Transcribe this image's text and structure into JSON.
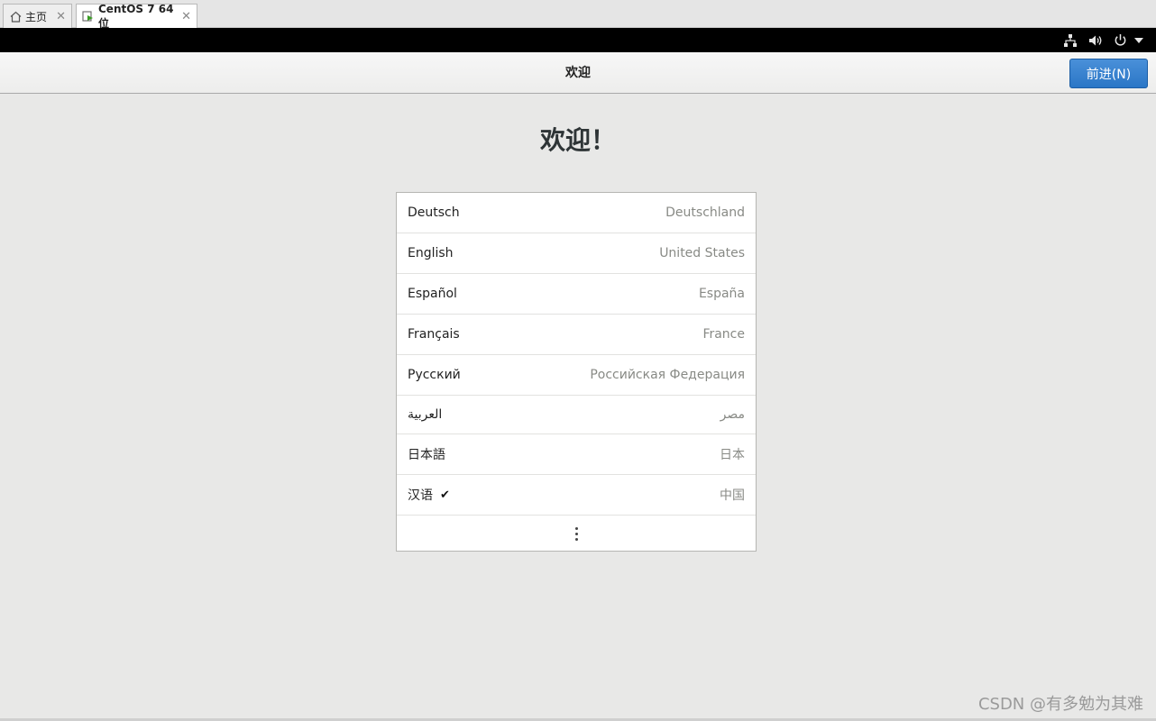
{
  "tabs": [
    {
      "label": "主页",
      "icon": "home-icon"
    },
    {
      "label": "CentOS 7 64 位",
      "icon": "vm-icon"
    }
  ],
  "tray": {
    "icons": [
      "network-icon",
      "volume-icon",
      "power-icon",
      "menu-caret-icon"
    ]
  },
  "header": {
    "title": "欢迎",
    "next_label": "前进(N)"
  },
  "main": {
    "heading": "欢迎！",
    "languages": [
      {
        "native": "Deutsch",
        "region": "Deutschland"
      },
      {
        "native": "English",
        "region": "United States"
      },
      {
        "native": "Español",
        "region": "España"
      },
      {
        "native": "Français",
        "region": "France"
      },
      {
        "native": "Русский",
        "region": "Российская Федерация"
      },
      {
        "native": "العربية",
        "region": "مصر"
      },
      {
        "native": "日本語",
        "region": "日本"
      },
      {
        "native": "汉语",
        "region": "中国",
        "check": "✔"
      }
    ]
  },
  "watermark": "CSDN @有多勉为其难",
  "colors": {
    "accent": "#2a76c6",
    "background": "#e8e8e7"
  }
}
